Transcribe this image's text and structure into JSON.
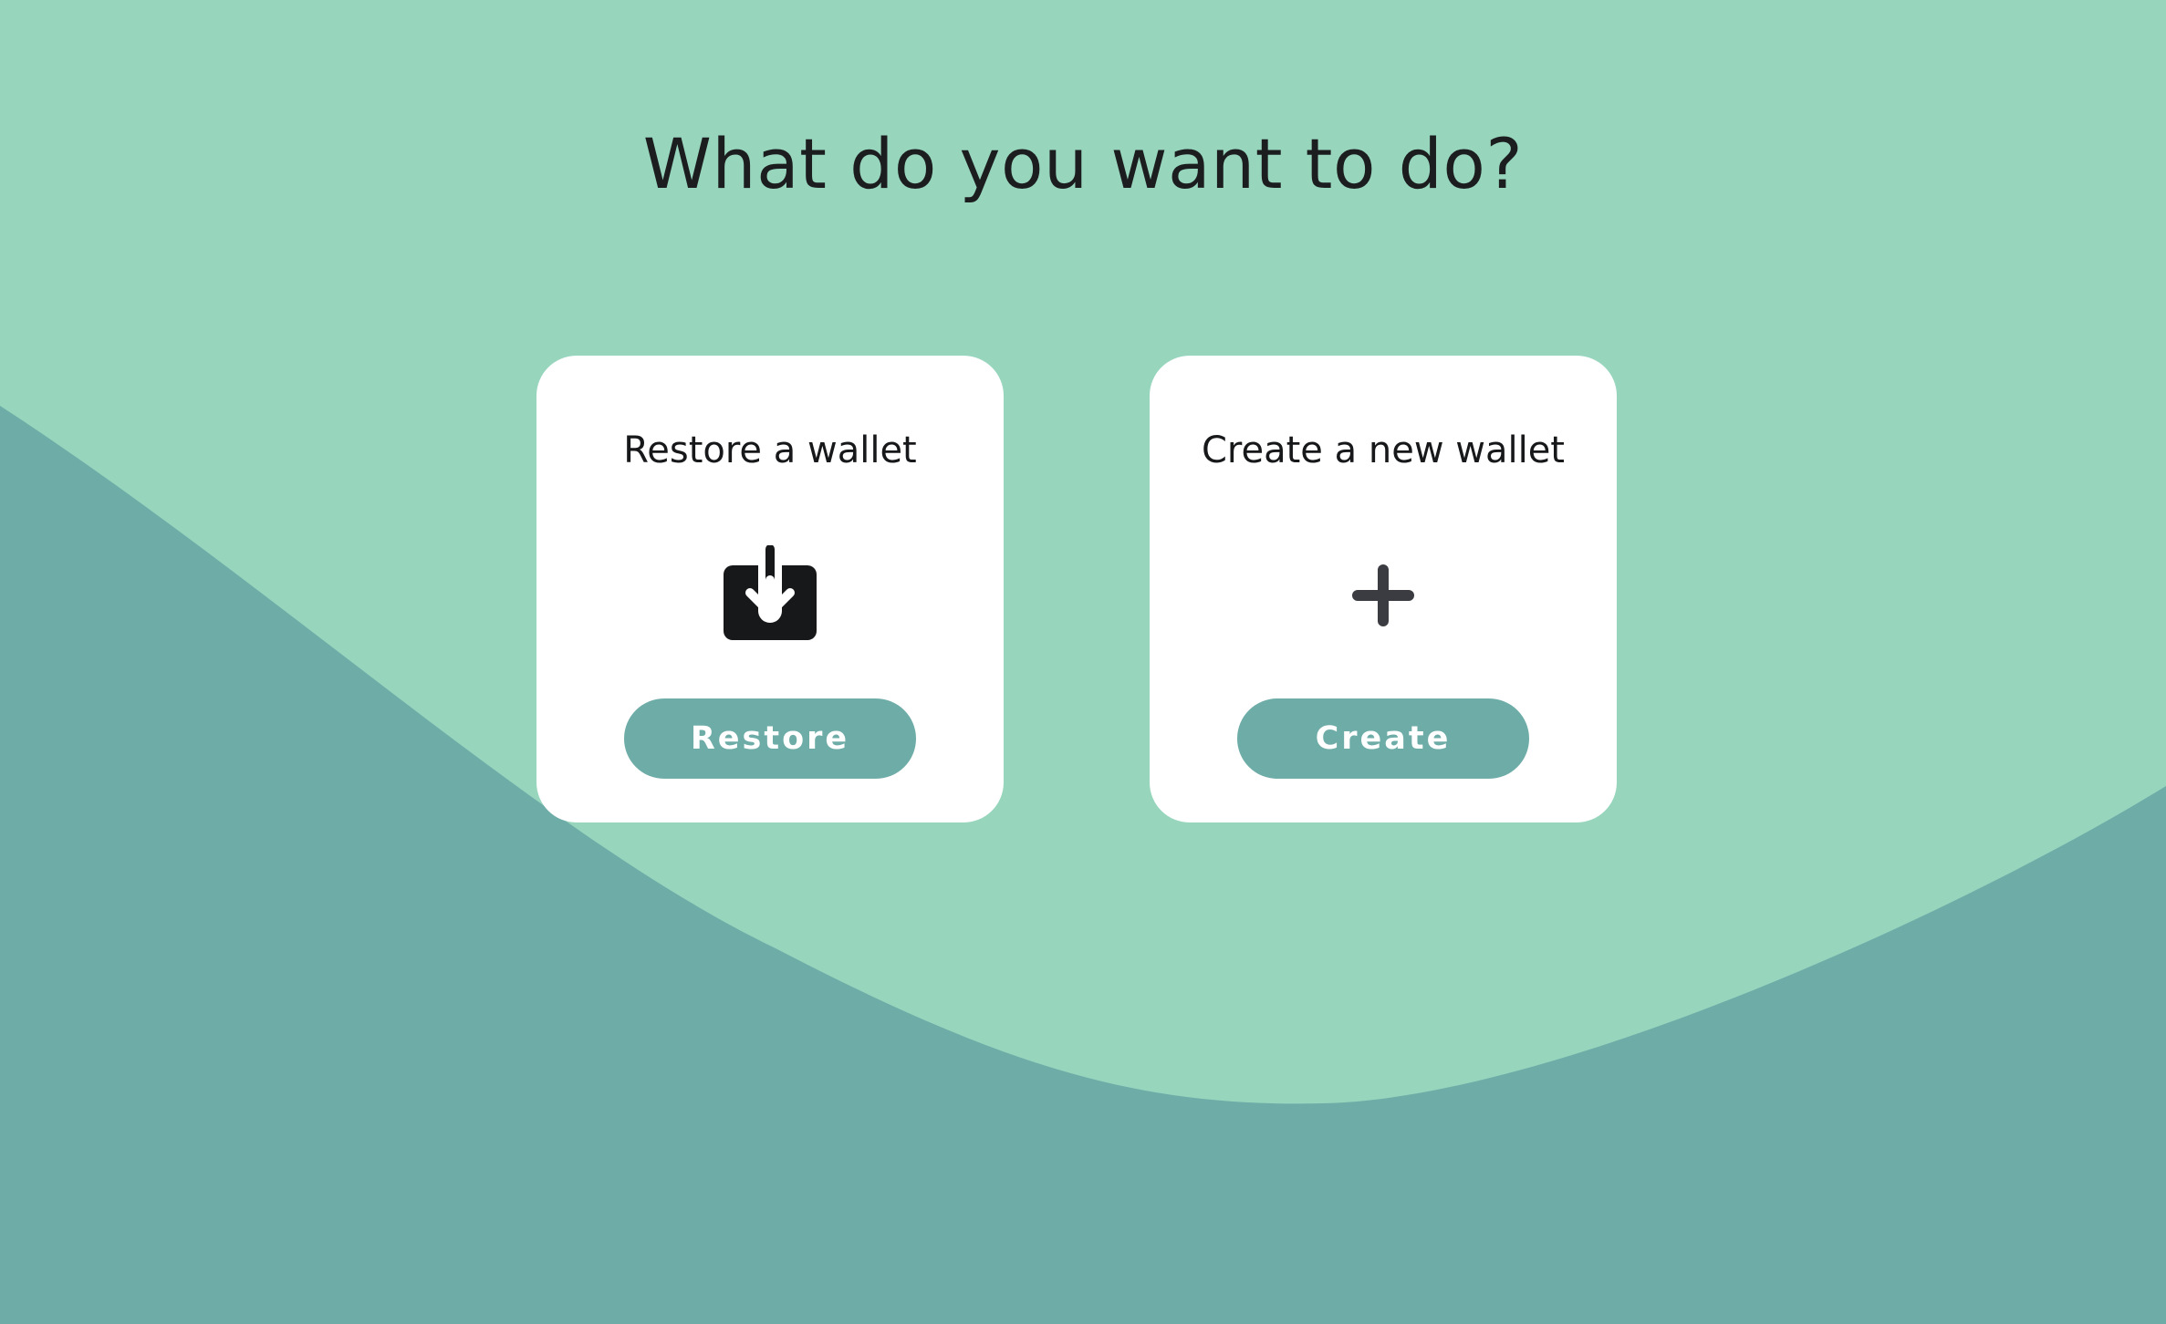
{
  "page": {
    "title": "What do you want to do?"
  },
  "colors": {
    "background_light": "#97d5bd",
    "background_dark": "#6eaca8",
    "card": "#ffffff",
    "button": "#6eaca8",
    "text": "#1b1d1f"
  },
  "options": [
    {
      "title": "Restore a wallet",
      "icon": "download-tray-icon",
      "button_label": "Restore"
    },
    {
      "title": "Create a new wallet",
      "icon": "plus-icon",
      "button_label": "Create"
    }
  ]
}
